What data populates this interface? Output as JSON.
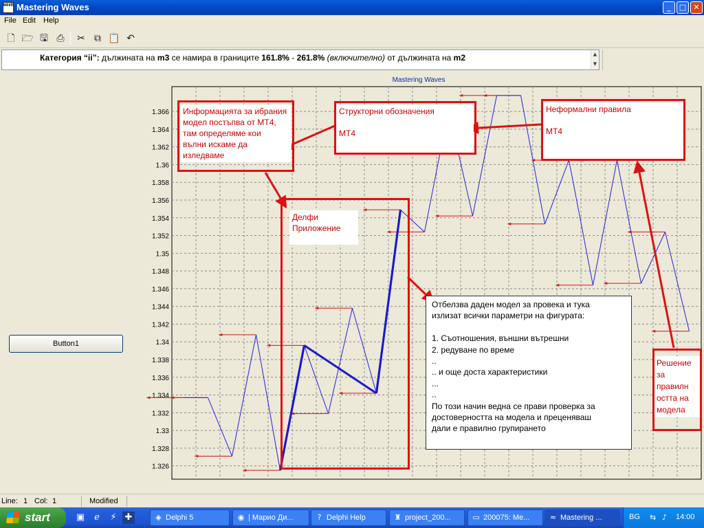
{
  "window": {
    "title": "Mastering Waves",
    "app_icon_text": "WAVE",
    "controls": {
      "minimize": "_",
      "maximize": "□",
      "close": "✕"
    }
  },
  "menu": [
    "File",
    "Edit",
    "Help"
  ],
  "toolbar": [
    "new-icon",
    "open-icon",
    "save-icon",
    "print-icon",
    "cut-icon",
    "copy-icon",
    "paste-icon",
    "undo-icon"
  ],
  "message": {
    "p1": "Категория “ii”: ",
    "p2": "дължината на ",
    "p3": "m3",
    "p4": " се намира в границите ",
    "p5": "161.8%",
    "p6": " - ",
    "p7": "261.8%",
    "p8": " (включително)",
    "p9": " от дължината на ",
    "p10": "m2",
    "scroll_up": "▲",
    "scroll_down": "▼"
  },
  "left_panel": {
    "button1": "Button1"
  },
  "chart_data": {
    "type": "line",
    "title": "Mastering Waves",
    "xlabel": "",
    "ylabel": "",
    "ylim": [
      1.3245,
      1.3688
    ],
    "yticks": [
      1.326,
      1.328,
      1.33,
      1.332,
      1.334,
      1.336,
      1.338,
      1.34,
      1.342,
      1.344,
      1.346,
      1.348,
      1.35,
      1.352,
      1.354,
      1.356,
      1.358,
      1.36,
      1.362,
      1.364,
      1.366
    ],
    "grid": true,
    "series": [
      {
        "values": [
          1.3337,
          1.3337,
          1.3271,
          1.3408,
          1.3255,
          1.3396,
          1.3319,
          1.3438,
          1.3342,
          1.3549,
          1.3524,
          1.3662,
          1.3542,
          1.3678,
          1.3678,
          1.3533,
          1.3605,
          1.3464,
          1.3605,
          1.3466,
          1.3524,
          1.3412
        ]
      }
    ],
    "highlight_segments": [
      [
        4,
        5
      ],
      [
        5,
        8
      ],
      [
        8,
        9
      ]
    ],
    "colors": {
      "line": "#2222dd",
      "highlight": "#1a1acc",
      "grid": "#8a8a8a",
      "arrow": "#dd1111"
    }
  },
  "annotations": {
    "info": "Информацията за ибрания\nмодел постъпва от МТ4,\nтам определяме кои\nвълни искаме да\nизледваме",
    "structural": "Структорни обозначения\n\n         МТ4",
    "informal": "Неформални правила\n\n          МТ4",
    "delphi": "Делфи\nПриложение",
    "main_note": "Отбелзва даден модел за провека и тука\nизлизат всички параметри на фигурата:\n\n1. Съотношения, външни вътрешни\n2. редуване по време\n..\n.. и още доста характеристики\n...\n..\nПо този начин ведна се прави проверка за\nдостоверността на модела и преценяваш\nдали е правилно групирането",
    "solution": "Решение\nза\nправилн\nостта на\nмодела"
  },
  "status": {
    "line_label": "Line:",
    "line": "1",
    "col_label": "Col:",
    "col": "1",
    "state": "Modified"
  },
  "taskbar": {
    "start": "start",
    "quicklaunch": [
      "desktop-icon",
      "ie-icon",
      "winamp-icon",
      "uk-flag-icon"
    ],
    "tasks": [
      {
        "label": "Delphi 5",
        "icon": "delphi-icon"
      },
      {
        "label": "| Марио Ди...",
        "icon": "chat-icon"
      },
      {
        "label": "Delphi Help",
        "icon": "help-icon"
      },
      {
        "label": "project_200...",
        "icon": "project-icon"
      },
      {
        "label": "200075: Ме...",
        "icon": "window-icon"
      },
      {
        "label": "Mastering ...",
        "icon": "wave-icon"
      }
    ],
    "lang": "BG",
    "time": "14:00"
  }
}
